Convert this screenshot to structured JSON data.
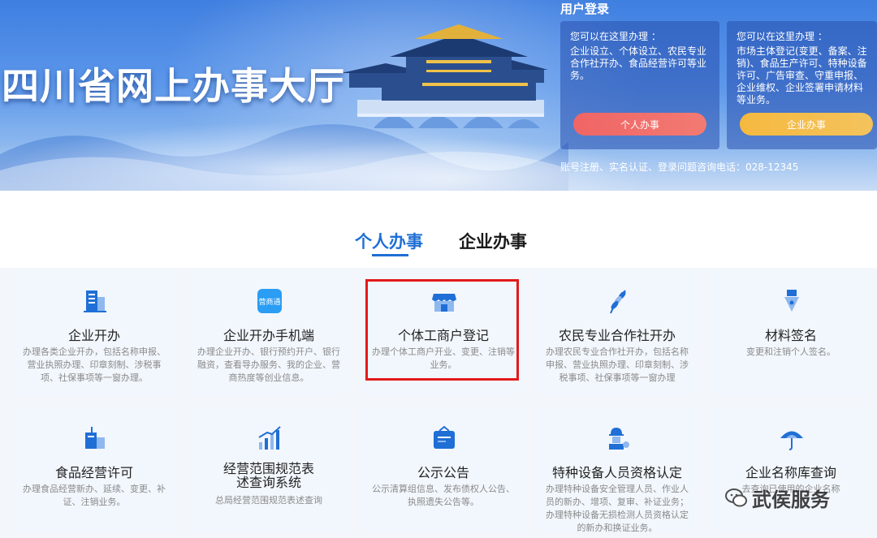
{
  "banner": {
    "title": "四川省网上办事大厅"
  },
  "login": {
    "title": "用户登录",
    "personal_box": {
      "intro": "您可以在这里办理 ：",
      "desc": "企业设立、个体设立、农民专业合作社开办、食品经营许可等业务。",
      "button": "个人办事"
    },
    "enterprise_box": {
      "intro": "您可以在这里办理 ：",
      "desc": "市场主体登记(变更、备案、注销)、食品生产许可、特种设备许可、广告审查、守重申报、企业维权、企业签署申请材料等业务。",
      "button": "企业办事"
    },
    "note": "账号注册、实名认证、登录问题咨询电话：028-12345"
  },
  "tabs": {
    "personal": "个人办事",
    "enterprise": "企业办事"
  },
  "cards": [
    {
      "icon": "building-icon",
      "title": "企业开办",
      "desc": "办理各类企业开办，包括名称申报、营业执照办理、印章刻制、涉税事项、社保事项等一窗办理。"
    },
    {
      "icon": "yingchuangtong-app-icon",
      "icon_text": "营商通",
      "title": "企业开办手机端",
      "desc": "办理企业开办、银行预约开户、银行融资，查看导办服务、我的企业、营商热度等创业信息。"
    },
    {
      "icon": "shop-icon",
      "title": "个体工商户登记",
      "desc": "办理个体工商户开业、变更、注销等业务。"
    },
    {
      "icon": "wheat-icon",
      "title": "农民专业合作社开办",
      "desc": "办理农民专业合作社开办，包括名称申报、营业执照办理、印章刻制、涉税事项、社保事项等一窗办理"
    },
    {
      "icon": "pen-nib-icon",
      "title": "材料签名",
      "desc": "变更和注销个人签名。"
    },
    {
      "icon": "food-cup-icon",
      "title": "食品经营许可",
      "desc": "办理食品经营新办、延续、变更、补证、注销业务。"
    },
    {
      "icon": "bar-chart-icon",
      "title": "经营范围规范表述查询系统",
      "desc": "总局经营范围规范表述查询"
    },
    {
      "icon": "notice-board-icon",
      "title": "公示公告",
      "desc": "公示清算组信息、发布债权人公告、执照遗失公告等。"
    },
    {
      "icon": "worker-icon",
      "title": "特种设备人员资格认定",
      "desc": "办理特种设备安全管理人员、作业人员的新办、增项、复审、补证业务；办理特种设备无损检测人员资格认定的新办和换证业务。"
    },
    {
      "icon": "umbrella-icon",
      "title": "企业名称库查询",
      "desc": "去查询已使用的企业名称"
    }
  ],
  "watermark": {
    "icon": "wechat-icon",
    "text": "武侯服务"
  },
  "colors": {
    "accent": "#1f6fd6",
    "highlight": "#e21a1a",
    "personal_button": "#f06565",
    "enterprise_button": "#f5b93f"
  }
}
